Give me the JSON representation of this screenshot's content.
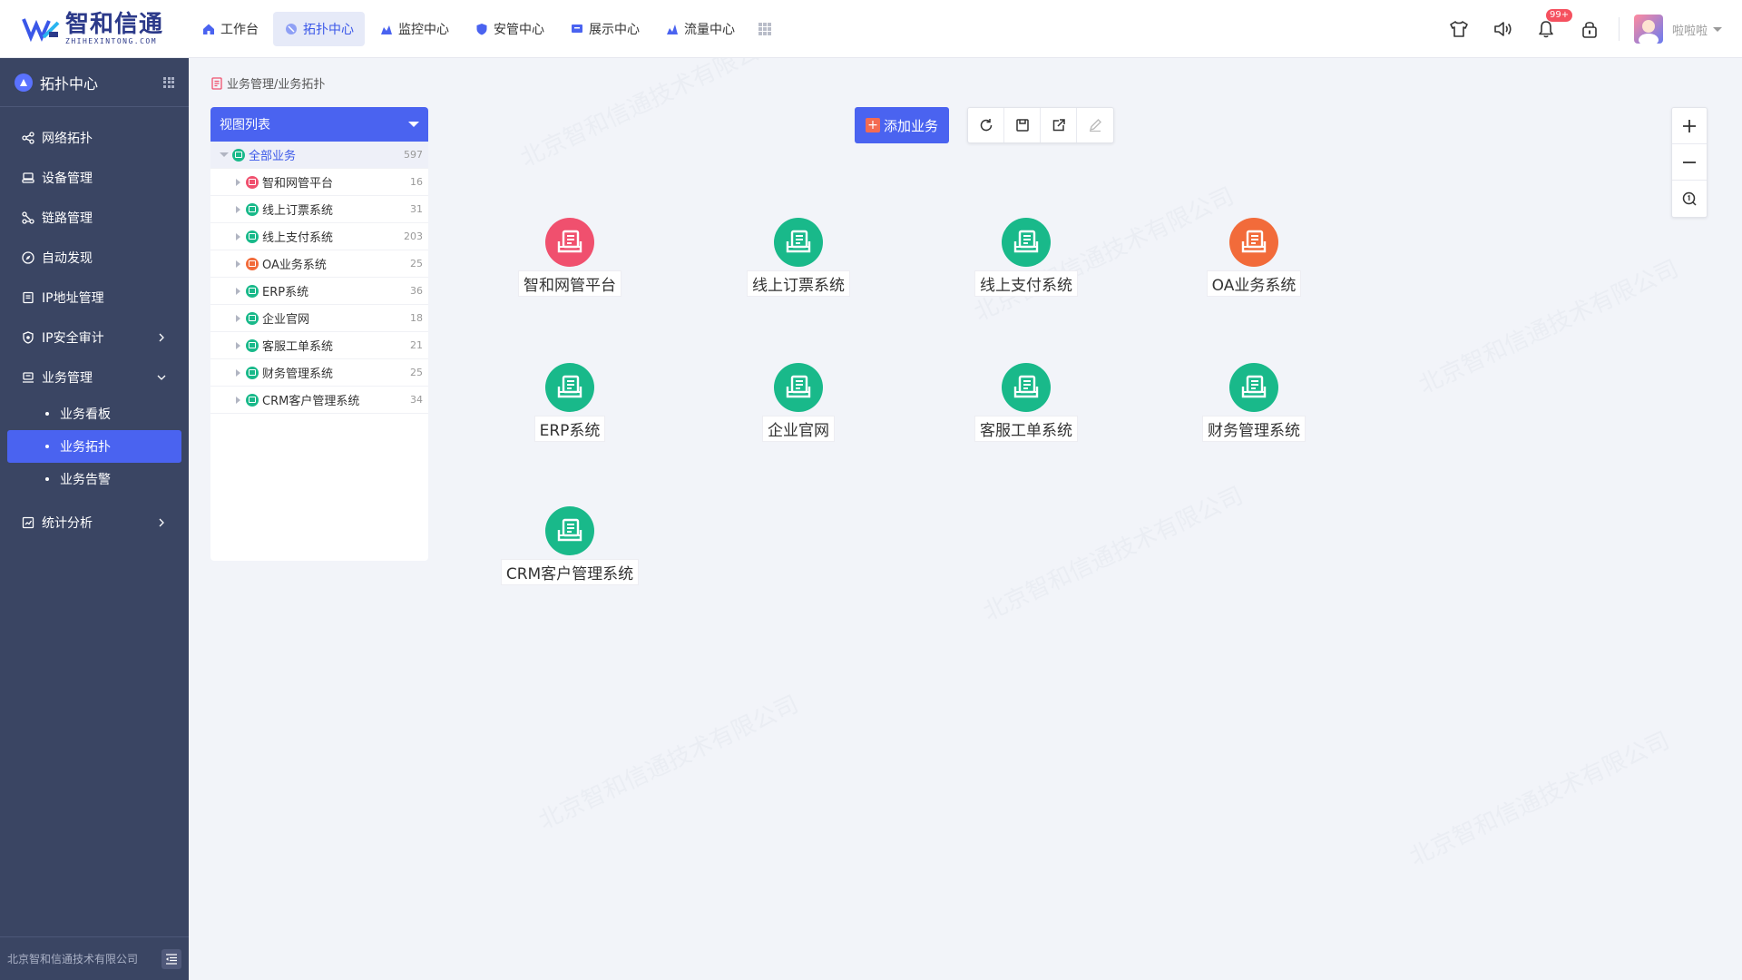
{
  "app": {
    "logo_name": "智和信通",
    "logo_sub": "ZHIHEXINTONG.COM"
  },
  "topnav": [
    {
      "label": "工作台",
      "icon": "home-icon",
      "active": false
    },
    {
      "label": "拓扑中心",
      "icon": "topology-icon",
      "active": true
    },
    {
      "label": "监控中心",
      "icon": "monitor-icon",
      "active": false
    },
    {
      "label": "安管中心",
      "icon": "shield-icon",
      "active": false
    },
    {
      "label": "展示中心",
      "icon": "display-icon",
      "active": false
    },
    {
      "label": "流量中心",
      "icon": "traffic-icon",
      "active": false
    }
  ],
  "header_right": {
    "notification_badge": "99+",
    "user_name": "啦啦啦"
  },
  "sidebar": {
    "title": "拓扑中心",
    "items": [
      {
        "label": "网络拓扑",
        "icon": "network-icon"
      },
      {
        "label": "设备管理",
        "icon": "device-icon"
      },
      {
        "label": "链路管理",
        "icon": "link-icon"
      },
      {
        "label": "自动发现",
        "icon": "compass-icon"
      },
      {
        "label": "IP地址管理",
        "icon": "ip-icon"
      },
      {
        "label": "IP安全审计",
        "icon": "shield-check-icon",
        "arrow": "right"
      },
      {
        "label": "业务管理",
        "icon": "business-icon",
        "arrow": "down"
      }
    ],
    "sub_items": [
      {
        "label": "业务看板",
        "active": false
      },
      {
        "label": "业务拓扑",
        "active": true
      },
      {
        "label": "业务告警",
        "active": false
      }
    ],
    "bottom_item": {
      "label": "统计分析",
      "icon": "stats-icon"
    },
    "footer": "北京智和信通技术有限公司"
  },
  "breadcrumb": "业务管理/业务拓扑",
  "panel": {
    "title": "视图列表",
    "root": {
      "name": "全部业务",
      "count": "597"
    },
    "children": [
      {
        "name": "智和网管平台",
        "count": "16",
        "color": "#f0506e"
      },
      {
        "name": "线上订票系统",
        "count": "31",
        "color": "#19b98a"
      },
      {
        "name": "线上支付系统",
        "count": "203",
        "color": "#19b98a"
      },
      {
        "name": "OA业务系统",
        "count": "25",
        "color": "#f26b3a"
      },
      {
        "name": "ERP系统",
        "count": "36",
        "color": "#19b98a"
      },
      {
        "name": "企业官网",
        "count": "18",
        "color": "#19b98a"
      },
      {
        "name": "客服工单系统",
        "count": "21",
        "color": "#19b98a"
      },
      {
        "name": "财务管理系统",
        "count": "25",
        "color": "#19b98a"
      },
      {
        "name": "CRM客户管理系统",
        "count": "34",
        "color": "#19b98a"
      }
    ]
  },
  "toolbar": {
    "add_label": "添加业务"
  },
  "topology": [
    {
      "label": "智和网管平台",
      "color": "#f0506e"
    },
    {
      "label": "线上订票系统",
      "color": "#19b98a"
    },
    {
      "label": "线上支付系统",
      "color": "#19b98a"
    },
    {
      "label": "OA业务系统",
      "color": "#f26b3a"
    },
    {
      "label": "ERP系统",
      "color": "#19b98a"
    },
    {
      "label": "企业官网",
      "color": "#19b98a"
    },
    {
      "label": "客服工单系统",
      "color": "#19b98a"
    },
    {
      "label": "财务管理系统",
      "color": "#19b98a"
    },
    {
      "label": "CRM客户管理系统",
      "color": "#19b98a"
    }
  ],
  "watermark_text": "北京智和信通技术有限公司",
  "colors": {
    "accent": "#4a63f0",
    "sidebar": "#3a4563",
    "ok": "#19b98a",
    "alarm": "#f0506e",
    "warning": "#f26b3a"
  }
}
